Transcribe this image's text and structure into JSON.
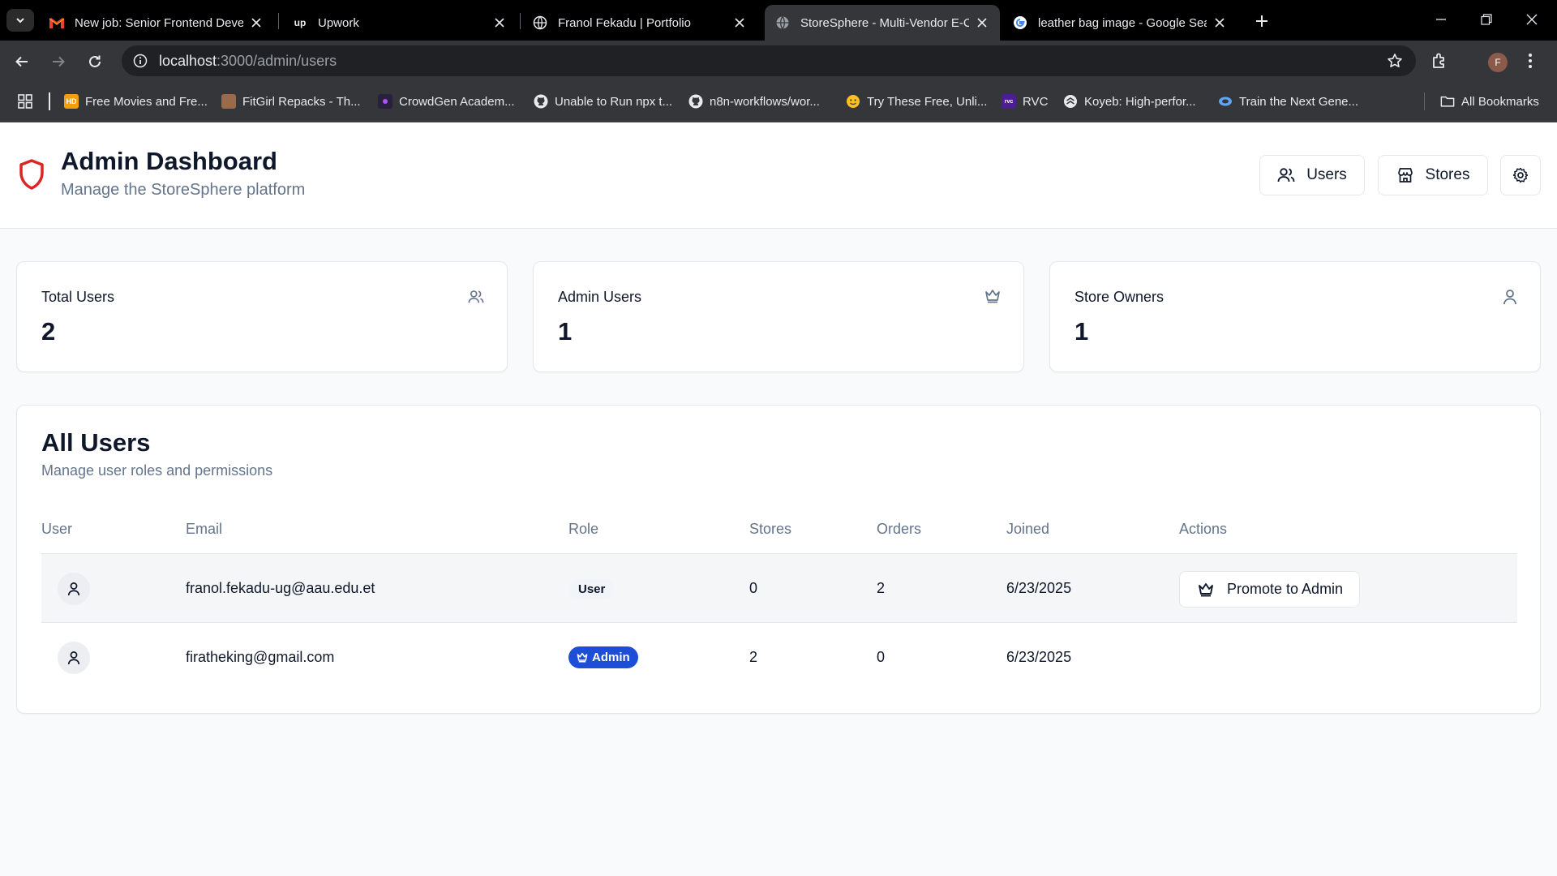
{
  "browser": {
    "tabs": [
      {
        "title": "New job: Senior Frontend Developer",
        "favicon": "gmail-icon"
      },
      {
        "title": "Upwork",
        "favicon": "upwork-icon"
      },
      {
        "title": "Franol Fekadu | Portfolio",
        "favicon": "globe-icon"
      },
      {
        "title": "StoreSphere - Multi-Vendor E-Commerce",
        "favicon": "globe-icon",
        "active": true
      },
      {
        "title": "leather bag image - Google Search",
        "favicon": "google-icon"
      }
    ],
    "url_host": "localhost",
    "url_path": ":3000/admin/users",
    "profile_initial": "F",
    "bookmarks": [
      {
        "label": "Free Movies and Fre...",
        "icon": "hd-icon"
      },
      {
        "label": "FitGirl Repacks - Th...",
        "icon": "fitgirl-icon"
      },
      {
        "label": "CrowdGen Academ...",
        "icon": "crowdgen-icon"
      },
      {
        "label": "Unable to Run npx t...",
        "icon": "github-icon"
      },
      {
        "label": "n8n-workflows/wor...",
        "icon": "github-icon"
      },
      {
        "label": "Try These Free, Unli...",
        "icon": "hugging-face-icon"
      },
      {
        "label": "RVC",
        "icon": "rvc-icon"
      },
      {
        "label": "Koyeb: High-perfor...",
        "icon": "koyeb-icon"
      },
      {
        "label": "Train the Next Gene...",
        "icon": "globe-icon"
      }
    ],
    "all_bookmarks_label": "All Bookmarks"
  },
  "header": {
    "title": "Admin Dashboard",
    "subtitle": "Manage the StoreSphere platform",
    "users_button": "Users",
    "stores_button": "Stores"
  },
  "stats": [
    {
      "label": "Total Users",
      "value": "2",
      "icon": "users-icon"
    },
    {
      "label": "Admin Users",
      "value": "1",
      "icon": "crown-icon"
    },
    {
      "label": "Store Owners",
      "value": "1",
      "icon": "user-icon"
    }
  ],
  "users_section": {
    "title": "All Users",
    "subtitle": "Manage user roles and permissions",
    "columns": [
      "User",
      "Email",
      "Role",
      "Stores",
      "Orders",
      "Joined",
      "Actions"
    ],
    "rows": [
      {
        "email": "franol.fekadu-ug@aau.edu.et",
        "role": "User",
        "stores": "0",
        "orders": "2",
        "joined": "6/23/2025",
        "action": "Promote to Admin"
      },
      {
        "email": "firatheking@gmail.com",
        "role": "Admin",
        "stores": "2",
        "orders": "0",
        "joined": "6/23/2025",
        "action": ""
      }
    ]
  },
  "colors": {
    "brand_shield": "#dc2626",
    "admin_badge": "#1d4ed8",
    "muted_text": "#64748b"
  }
}
